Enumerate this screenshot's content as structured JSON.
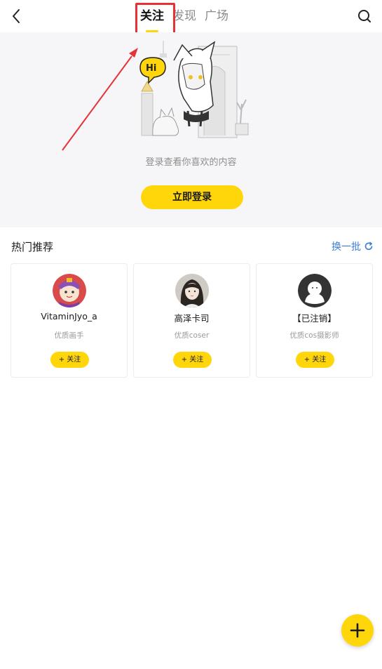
{
  "header": {
    "tabs": [
      {
        "label": "关注",
        "active": true
      },
      {
        "label": "发现",
        "active": false
      },
      {
        "label": "广场",
        "active": false
      }
    ],
    "back_icon": "chevron-left-icon",
    "search_icon": "search-icon"
  },
  "banner": {
    "bubble_text": "Hi",
    "hint": "登录查看你喜欢的内容",
    "login_label": "立即登录"
  },
  "recommend": {
    "title": "热门推荐",
    "refresh_label": "换一批",
    "cards": [
      {
        "name": "VitaminJyo_a",
        "desc": "优质画手",
        "follow_label": "+ 关注"
      },
      {
        "name": "高泽卡司",
        "desc": "优质coser",
        "follow_label": "+ 关注"
      },
      {
        "name": "【已注销】",
        "desc": "优质cos摄影师",
        "follow_label": "+ 关注"
      }
    ]
  },
  "fab": {
    "icon": "plus-icon"
  },
  "colors": {
    "accent": "#ffd60a",
    "link": "#3b7fd4",
    "annotation": "#e63236",
    "banner_bg": "#f6f6f8"
  }
}
